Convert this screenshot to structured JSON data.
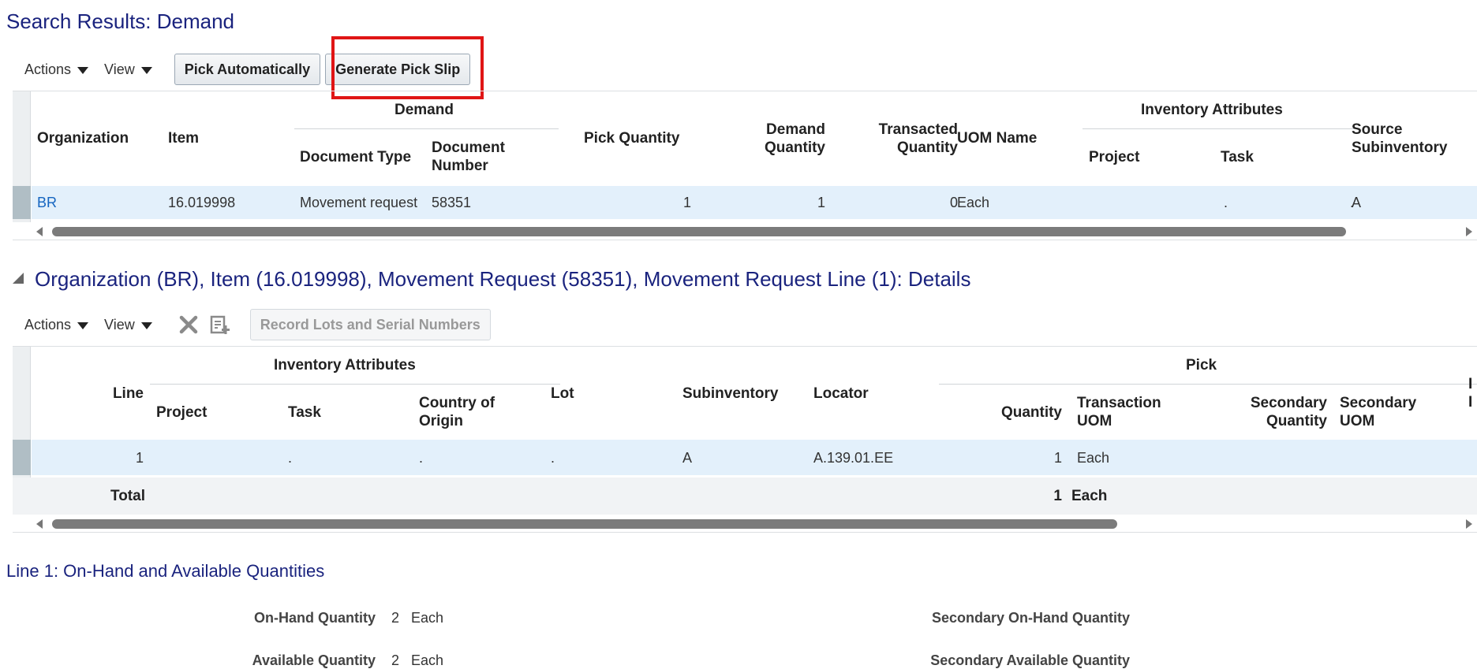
{
  "search": {
    "title": "Search Results: Demand",
    "toolbar": {
      "actions": "Actions",
      "view": "View",
      "pick_auto": "Pick Automatically",
      "gen_pick_slip": "Generate Pick Slip"
    },
    "columns": {
      "organization": "Organization",
      "item": "Item",
      "demand_group": "Demand",
      "doc_type": "Document Type",
      "doc_number_1": "Document",
      "doc_number_2": "Number",
      "pick_qty": "Pick Quantity",
      "demand_qty_1": "Demand",
      "demand_qty_2": "Quantity",
      "trans_qty_1": "Transacted",
      "trans_qty_2": "Quantity",
      "uom": "UOM Name",
      "inv_attr_group": "Inventory Attributes",
      "project": "Project",
      "task": "Task",
      "source_sub_1": "Source",
      "source_sub_2": "Subinventory"
    },
    "row": {
      "organization": "BR",
      "item": "16.019998",
      "doc_type": "Movement request",
      "doc_number": "58351",
      "pick_qty": "1",
      "demand_qty": "1",
      "trans_qty": "0",
      "uom": "Each",
      "project": "",
      "task": ".",
      "dot": ".",
      "source_sub": "A"
    }
  },
  "details": {
    "title": "Organization (BR), Item (16.019998), Movement Request (58351), Movement Request Line (1): Details",
    "toolbar": {
      "actions": "Actions",
      "view": "View",
      "record_lots": "Record Lots and Serial Numbers"
    },
    "columns": {
      "line": "Line",
      "inv_attr_group": "Inventory Attributes",
      "project": "Project",
      "task": "Task",
      "coo_1": "Country of",
      "coo_2": "Origin",
      "lot": "Lot",
      "subinventory": "Subinventory",
      "locator": "Locator",
      "pick_group": "Pick",
      "quantity": "Quantity",
      "trans_uom_1": "Transaction",
      "trans_uom_2": "UOM",
      "sec_qty_1": "Secondary",
      "sec_qty_2": "Quantity",
      "sec_uom_1": "Secondary",
      "sec_uom_2": "UOM",
      "cut_1": "I",
      "cut_2": "I"
    },
    "row": {
      "line": "1",
      "project_dot": ".",
      "task_dot": ".",
      "coo_dot": ".",
      "subinventory": "A",
      "locator": "A.139.01.EE",
      "quantity": "1",
      "trans_uom": "Each"
    },
    "total": {
      "label": "Total",
      "quantity": "1",
      "uom": "Each"
    }
  },
  "onhand": {
    "title": "Line 1: On-Hand and Available Quantities",
    "onhand_label": "On-Hand Quantity",
    "onhand_value": "2",
    "onhand_uom": "Each",
    "avail_label": "Available Quantity",
    "avail_value": "2",
    "avail_uom": "Each",
    "sec_onhand_label": "Secondary On-Hand Quantity",
    "sec_avail_label": "Secondary Available Quantity"
  }
}
